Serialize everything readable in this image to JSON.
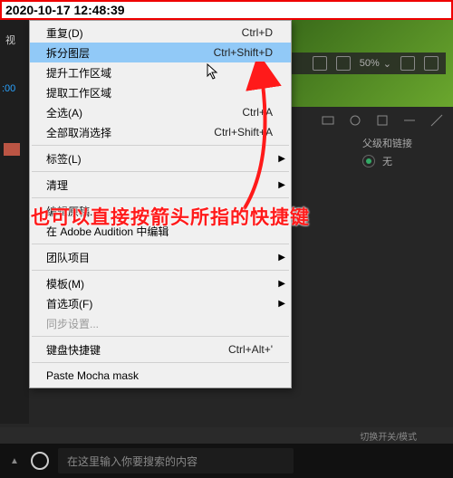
{
  "timestamp": "2020-10-17 12:48:39",
  "left": {
    "chip": "视",
    "time": ":00"
  },
  "toolbar": {
    "zoom": "50%"
  },
  "panel": {
    "parentLabel": "父级和链接",
    "noneLabel": "无"
  },
  "menu": {
    "duplicate": {
      "label": "重复(D)",
      "shortcut": "Ctrl+D"
    },
    "split": {
      "label": "拆分图层",
      "shortcut": "Ctrl+Shift+D"
    },
    "liftWork": {
      "label": "提升工作区域"
    },
    "extractWork": {
      "label": "提取工作区域"
    },
    "selectAll": {
      "label": "全选(A)",
      "shortcut": "Ctrl+A"
    },
    "deselectAll": {
      "label": "全部取消选择",
      "shortcut": "Ctrl+Shift+A"
    },
    "label": {
      "label": "标签(L)"
    },
    "purge": {
      "label": "清理"
    },
    "editOriginal": {
      "label": "编辑原稿..."
    },
    "editAudition": {
      "label": "在 Adobe Audition 中编辑"
    },
    "teamProj": {
      "label": "团队项目"
    },
    "template": {
      "label": "模板(M)"
    },
    "prefs": {
      "label": "首选项(F)"
    },
    "syncSettings": {
      "label": "同步设置..."
    },
    "keyboard": {
      "label": "键盘快捷键",
      "shortcut": "Ctrl+Alt+'"
    },
    "pasteMocha": {
      "label": "Paste Mocha mask"
    }
  },
  "hint": "也可以直接按箭头所指的快捷键",
  "footer": {
    "switchLabel": "切换开关/模式"
  },
  "taskbar": {
    "searchPlaceholder": "在这里输入你要搜索的内容"
  }
}
